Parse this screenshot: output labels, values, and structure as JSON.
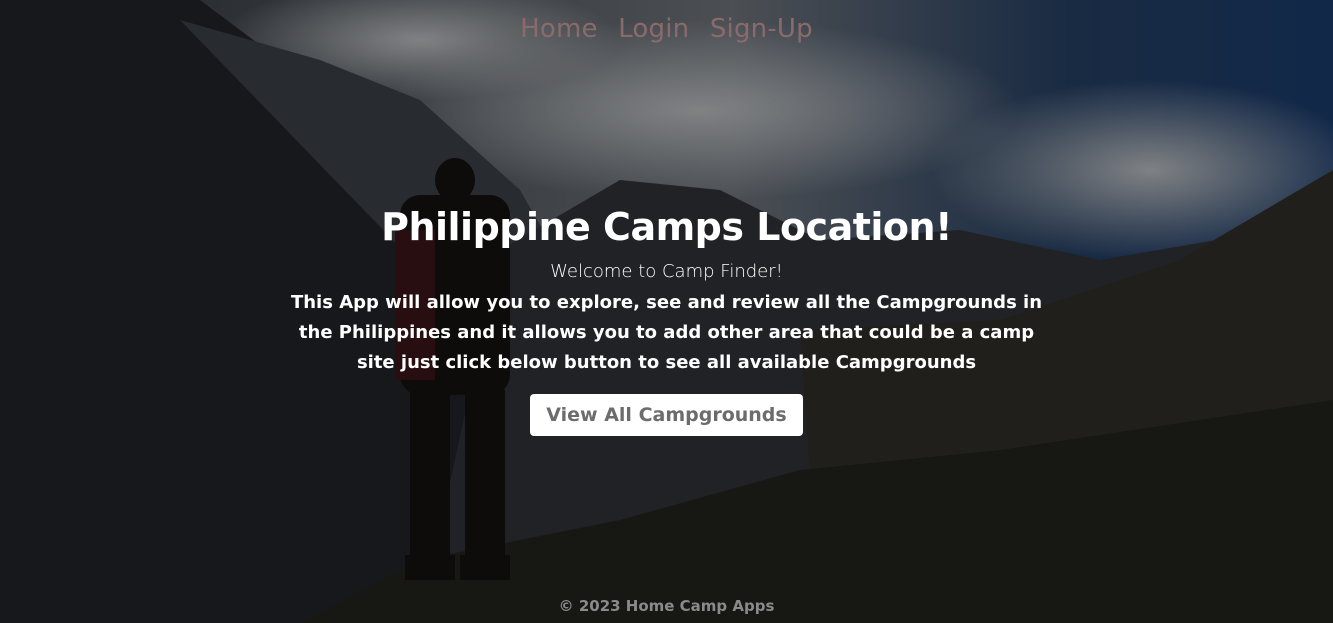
{
  "nav": {
    "items": [
      {
        "label": "Home"
      },
      {
        "label": "Login"
      },
      {
        "label": "Sign-Up"
      }
    ]
  },
  "hero": {
    "title": "Philippine Camps Location!",
    "welcome": "Welcome to Camp Finder!",
    "description": "This App will allow you to explore, see and review all the Campgrounds in the Philippines and it allows you to add other area that could be a camp site just click below button to see all available Campgrounds",
    "cta_label": "View All Campgrounds"
  },
  "footer": {
    "text": "© 2023 Home Camp Apps"
  },
  "colors": {
    "nav_link": "#8a6b6b",
    "button_bg": "#ffffff",
    "button_text": "#6c6c6c"
  }
}
